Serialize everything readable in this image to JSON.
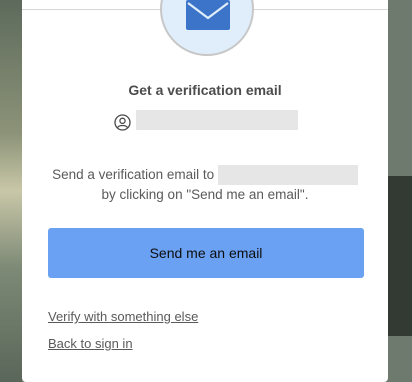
{
  "card": {
    "title": "Get a verification email",
    "description_prefix": "Send a verification email to",
    "description_suffix": "by clicking on \"Send me an email\".",
    "primary_button": "Send me an email",
    "verify_other_link": "Verify with something else",
    "back_link": "Back to sign in"
  },
  "icons": {
    "emblem": "mail-envelope-icon",
    "user": "user-circle-icon"
  },
  "colors": {
    "primary_button": "#6aa1f2",
    "emblem_background": "#e0eefb",
    "envelope": "#3b74c9"
  }
}
